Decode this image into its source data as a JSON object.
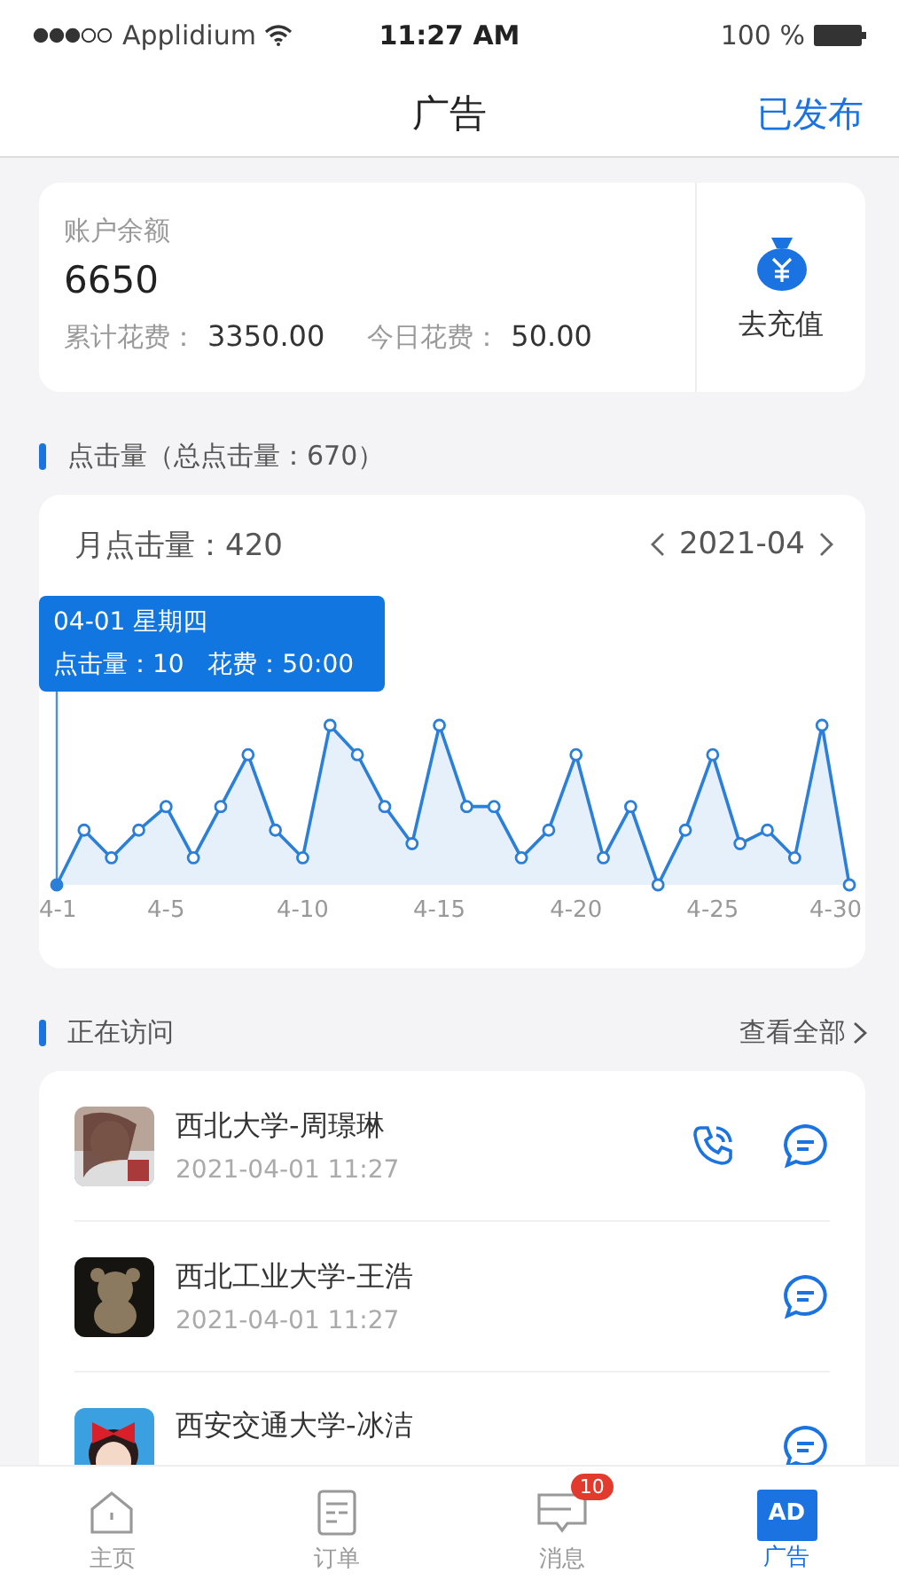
{
  "status_bar": {
    "carrier": "Applidium",
    "time": "11:27 AM",
    "battery": "100 %"
  },
  "nav": {
    "title": "广告",
    "action": "已发布"
  },
  "balance": {
    "label": "账户余额",
    "amount": "6650",
    "total_label": "累计花费：",
    "total": "3350.00",
    "today_label": "今日花费：",
    "today": "50.00",
    "recharge": "去充值"
  },
  "clicks_section": {
    "title": "点击量（总点击量：670）"
  },
  "chart_card": {
    "month_label": "月点击量：",
    "month_value": "420",
    "month": "2021-04",
    "tooltip_title": "04-01 星期四",
    "tooltip_body": "点击量：10   花费：50:00",
    "x_labels": [
      "4-1",
      "4-5",
      "4-10",
      "4-15",
      "4-20",
      "4-25",
      "4-30"
    ]
  },
  "visitors_section": {
    "title": "正在访问",
    "more": "查看全部"
  },
  "visitors": [
    {
      "name": "西北大学-周璟琳",
      "time": "2021-04-01 11:27",
      "phone": true
    },
    {
      "name": "西北工业大学-王浩",
      "time": "2021-04-01 11:27",
      "phone": false
    },
    {
      "name": "西安交通大学-冰洁",
      "phone": false
    }
  ],
  "tab_bar": [
    {
      "label": "主页",
      "selected": false
    },
    {
      "label": "订单",
      "selected": false
    },
    {
      "label": "消息",
      "selected": false,
      "badge": "10"
    },
    {
      "label": "广告",
      "selected": true,
      "icon_text": "AD"
    }
  ]
}
